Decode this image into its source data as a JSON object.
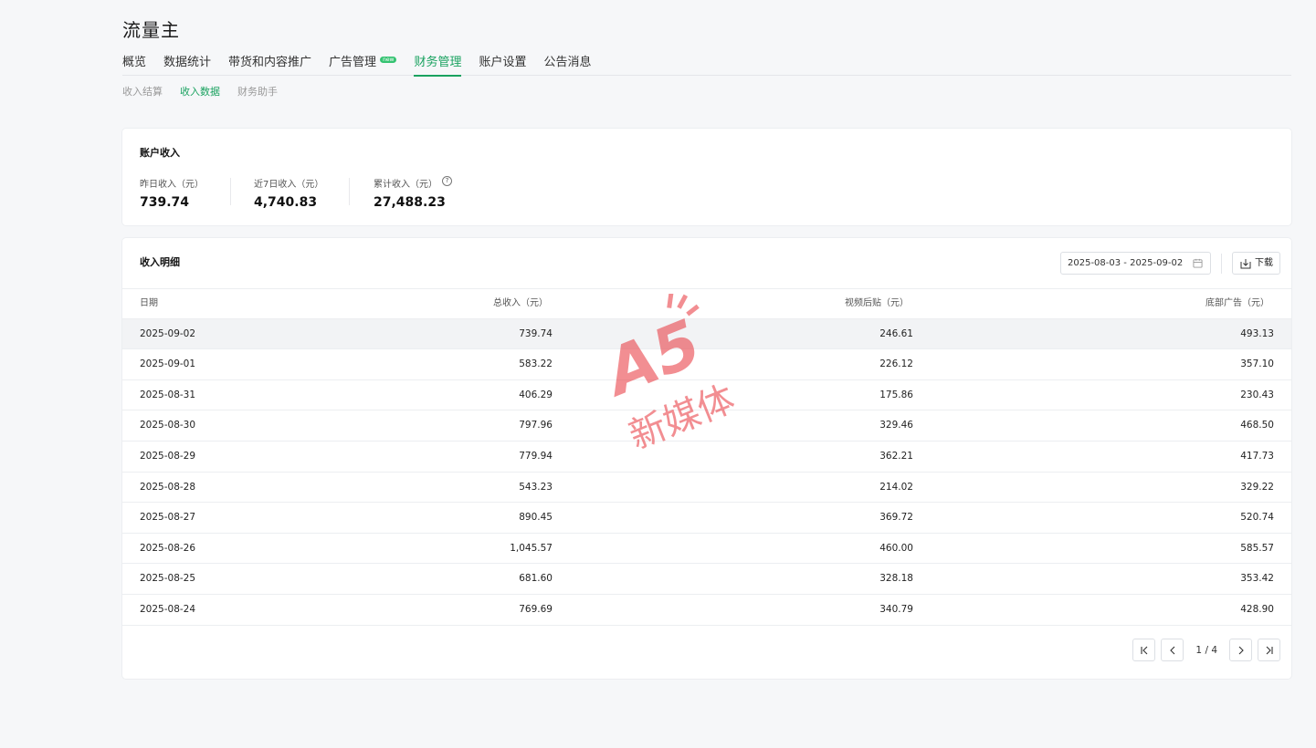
{
  "app": {
    "title": "流量主"
  },
  "main_nav": {
    "tabs": [
      {
        "label": "概览"
      },
      {
        "label": "数据统计"
      },
      {
        "label": "带货和内容推广"
      },
      {
        "label": "广告管理",
        "badge": "new"
      },
      {
        "label": "财务管理",
        "active": true
      },
      {
        "label": "账户设置"
      },
      {
        "label": "公告消息"
      }
    ]
  },
  "sub_nav": {
    "items": [
      {
        "label": "收入结算"
      },
      {
        "label": "收入数据",
        "active": true
      },
      {
        "label": "财务助手"
      }
    ]
  },
  "account_income": {
    "title": "账户收入",
    "stats": [
      {
        "label": "昨日收入（元）",
        "value": "739.74"
      },
      {
        "label": "近7日收入（元）",
        "value": "4,740.83"
      },
      {
        "label": "累计收入（元）",
        "value": "27,488.23"
      }
    ],
    "help_icon": "question-circle-icon"
  },
  "income_detail": {
    "title": "收入明细",
    "date_range": "2025-08-03 - 2025-09-02",
    "download_label": "下载",
    "columns": [
      "日期",
      "总收入（元）",
      "视频后贴（元）",
      "底部广告（元）"
    ],
    "rows": [
      [
        "2025-09-02",
        "739.74",
        "246.61",
        "493.13"
      ],
      [
        "2025-09-01",
        "583.22",
        "226.12",
        "357.10"
      ],
      [
        "2025-08-31",
        "406.29",
        "175.86",
        "230.43"
      ],
      [
        "2025-08-30",
        "797.96",
        "329.46",
        "468.50"
      ],
      [
        "2025-08-29",
        "779.94",
        "362.21",
        "417.73"
      ],
      [
        "2025-08-28",
        "543.23",
        "214.02",
        "329.22"
      ],
      [
        "2025-08-27",
        "890.45",
        "369.72",
        "520.74"
      ],
      [
        "2025-08-26",
        "1,045.57",
        "460.00",
        "585.57"
      ],
      [
        "2025-08-25",
        "681.60",
        "328.18",
        "353.42"
      ],
      [
        "2025-08-24",
        "769.69",
        "340.79",
        "428.90"
      ]
    ],
    "pagination": {
      "text": "1 / 4"
    }
  },
  "watermark": {
    "text": "新媒体",
    "logo": "A5"
  },
  "colors": {
    "accent": "#1aa260",
    "background": "#f6f7f9",
    "watermark": "#e8333a"
  }
}
